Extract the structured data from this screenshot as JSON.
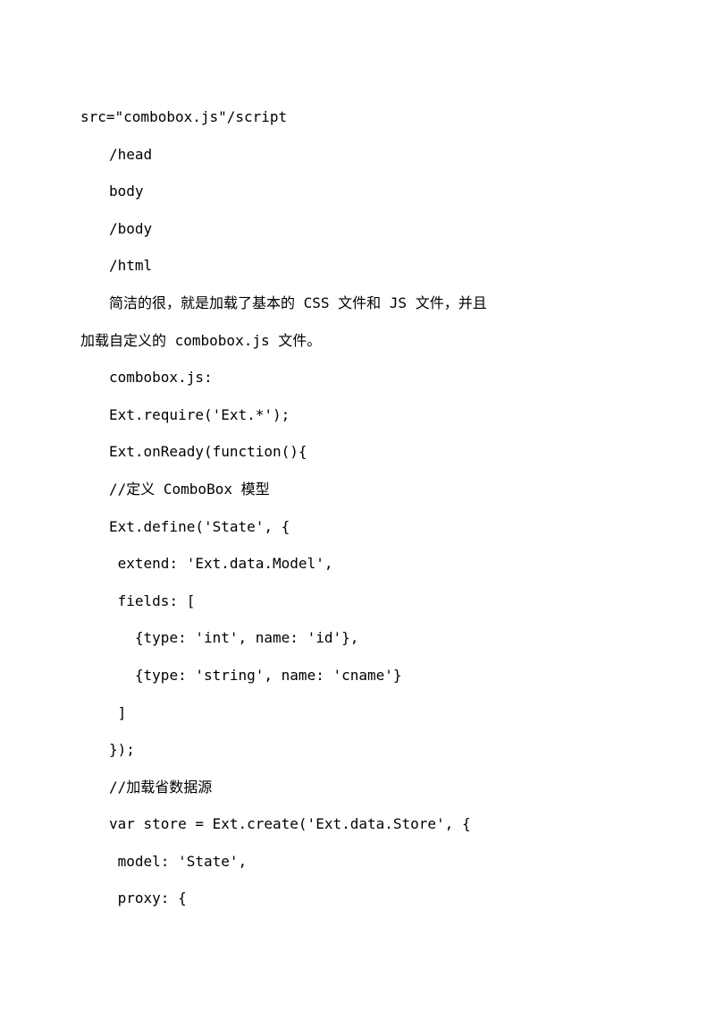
{
  "document": {
    "lines": [
      {
        "cls": "line-no-indent mono",
        "text": "src=\"combobox.js\"/script"
      },
      {
        "cls": "line mono",
        "text": "/head"
      },
      {
        "cls": "line mono",
        "text": "body"
      },
      {
        "cls": "line mono",
        "text": "/body"
      },
      {
        "cls": "line mono",
        "text": "/html"
      },
      {
        "cls": "line mono",
        "text": "简洁的很，就是加载了基本的 CSS 文件和 JS 文件，并且"
      },
      {
        "cls": "line-no-indent mono",
        "text": "加载自定义的 combobox.js 文件。"
      },
      {
        "cls": "line mono",
        "text": "combobox.js:"
      },
      {
        "cls": "line mono",
        "text": "Ext.require('Ext.*');"
      },
      {
        "cls": "line mono",
        "text": "Ext.onReady(function(){"
      },
      {
        "cls": "line mono",
        "text": "//定义 ComboBox 模型"
      },
      {
        "cls": "line mono",
        "text": "Ext.define('State', {"
      },
      {
        "cls": "line mono",
        "text": " extend: 'Ext.data.Model',"
      },
      {
        "cls": "line mono",
        "text": " fields: ["
      },
      {
        "cls": "line mono",
        "text": "   {type: 'int', name: 'id'},"
      },
      {
        "cls": "line mono",
        "text": "   {type: 'string', name: 'cname'}"
      },
      {
        "cls": "line mono",
        "text": " ]"
      },
      {
        "cls": "line mono",
        "text": "});"
      },
      {
        "cls": "line mono",
        "text": "//加载省数据源"
      },
      {
        "cls": "line mono",
        "text": "var store = Ext.create('Ext.data.Store', {"
      },
      {
        "cls": "line mono",
        "text": " model: 'State',"
      },
      {
        "cls": "line mono",
        "text": " proxy: {"
      }
    ]
  }
}
